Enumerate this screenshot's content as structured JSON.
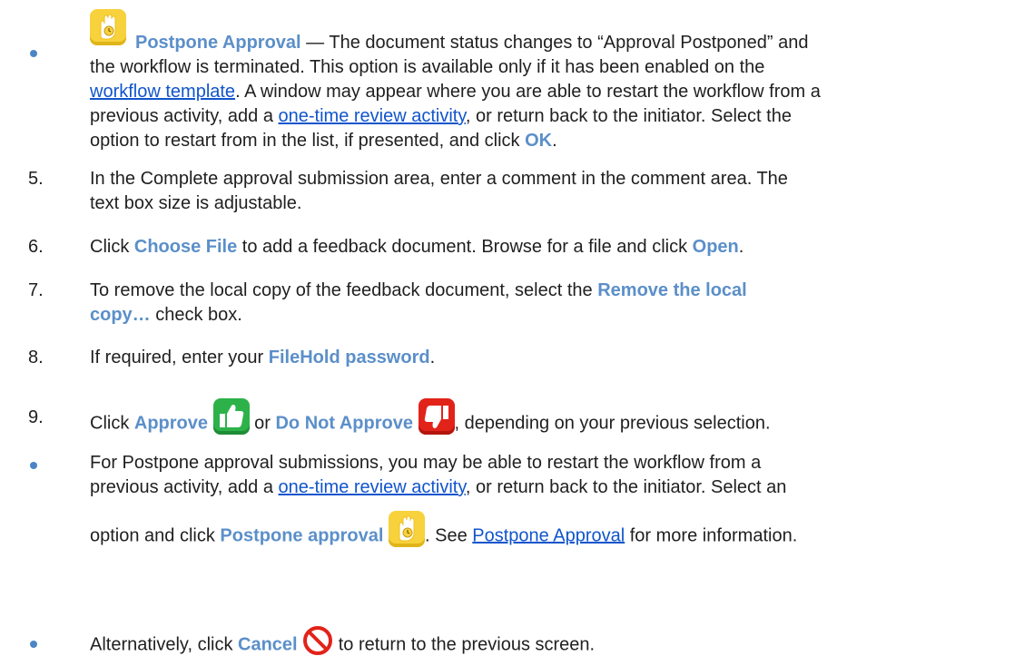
{
  "postpone_item": {
    "icon": "hand-clock-icon",
    "title": "Postpone Approval",
    "dash": " — ",
    "text_1": "The document status changes to “Approval Postponed” and",
    "text_2": "the workflow is terminated. This option is available only if it has been enabled on the",
    "link_workflow_template": "workflow template",
    "text_3": ". A window may appear where you are able to restart the workflow from a",
    "text_4": "previous activity, add a ",
    "link_one_time_review": "one-time review activity",
    "text_5": ", or return back to the initiator. Select the",
    "text_6": "option to restart from in the list, if presented, and click ",
    "ok_label": "OK",
    "end": "."
  },
  "steps": [
    {
      "number": "5.",
      "line_1": "In the Complete approval submission area, enter a comment in the comment area. The",
      "line_2": "text box size is adjustable."
    },
    {
      "number": "6.",
      "pre": "Click ",
      "kw_1": "Choose File",
      "mid": " to add a feedback document. Browse for a file and click ",
      "kw_2": "Open",
      "end": "."
    },
    {
      "number": "7.",
      "pre": "To remove the local copy of the feedback document, select the ",
      "kw_1": "Remove the local",
      "kw_2": "copy…",
      "end": " check box."
    },
    {
      "number": "8.",
      "pre": "If required, enter your ",
      "kw_1": "FileHold password",
      "end": "."
    },
    {
      "number": "9.",
      "pre": "Click ",
      "kw_1": "Approve",
      "mid": " or ",
      "kw_2": "Do Not Approve",
      "end": ", depending on your previous selection."
    }
  ],
  "postpone_bullet": {
    "line_1": "For Postpone approval submissions, you may be able to restart the workflow from a",
    "pre_2": "previous activity, add a ",
    "link_one_time_review": "one-time review activity",
    "post_2": ", or return back to the initiator. Select an",
    "pre_3": "option and click ",
    "kw_postpone": "Postpone approval",
    "mid_3": ". See ",
    "link_postpone_approval": "Postpone Approval",
    "end_3": " for more information."
  },
  "cancel_bullet": {
    "pre": "Alternatively, click ",
    "kw_cancel": "Cancel",
    "end": " to return to the previous screen."
  },
  "icons": {
    "approve": "thumbs-up-icon",
    "do_not_approve": "thumbs-down-icon",
    "cancel": "no-entry-icon"
  },
  "colors": {
    "keyword": "#5b8fc9",
    "link": "#1155cc",
    "approve_green": "#2db24a",
    "reject_red": "#e2231a",
    "postpone_yellow": "#f7d23c"
  }
}
